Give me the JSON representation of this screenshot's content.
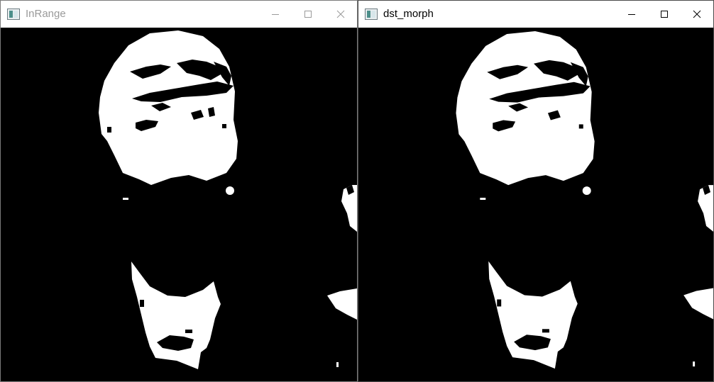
{
  "windows": [
    {
      "title": "InRange",
      "state": "inactive",
      "icon": "opencv-window-icon",
      "controls": [
        "minimize-icon",
        "maximize-icon",
        "close-icon"
      ],
      "content": "binary-mask-image"
    },
    {
      "title": "dst_morph",
      "state": "active",
      "icon": "opencv-window-icon",
      "controls": [
        "minimize-icon",
        "maximize-icon",
        "close-icon"
      ],
      "content": "binary-mask-image"
    }
  ],
  "colors": {
    "mask_foreground": "#ffffff",
    "mask_background": "#000000",
    "inactive_title": "#9a9a9a",
    "active_title": "#000000"
  }
}
